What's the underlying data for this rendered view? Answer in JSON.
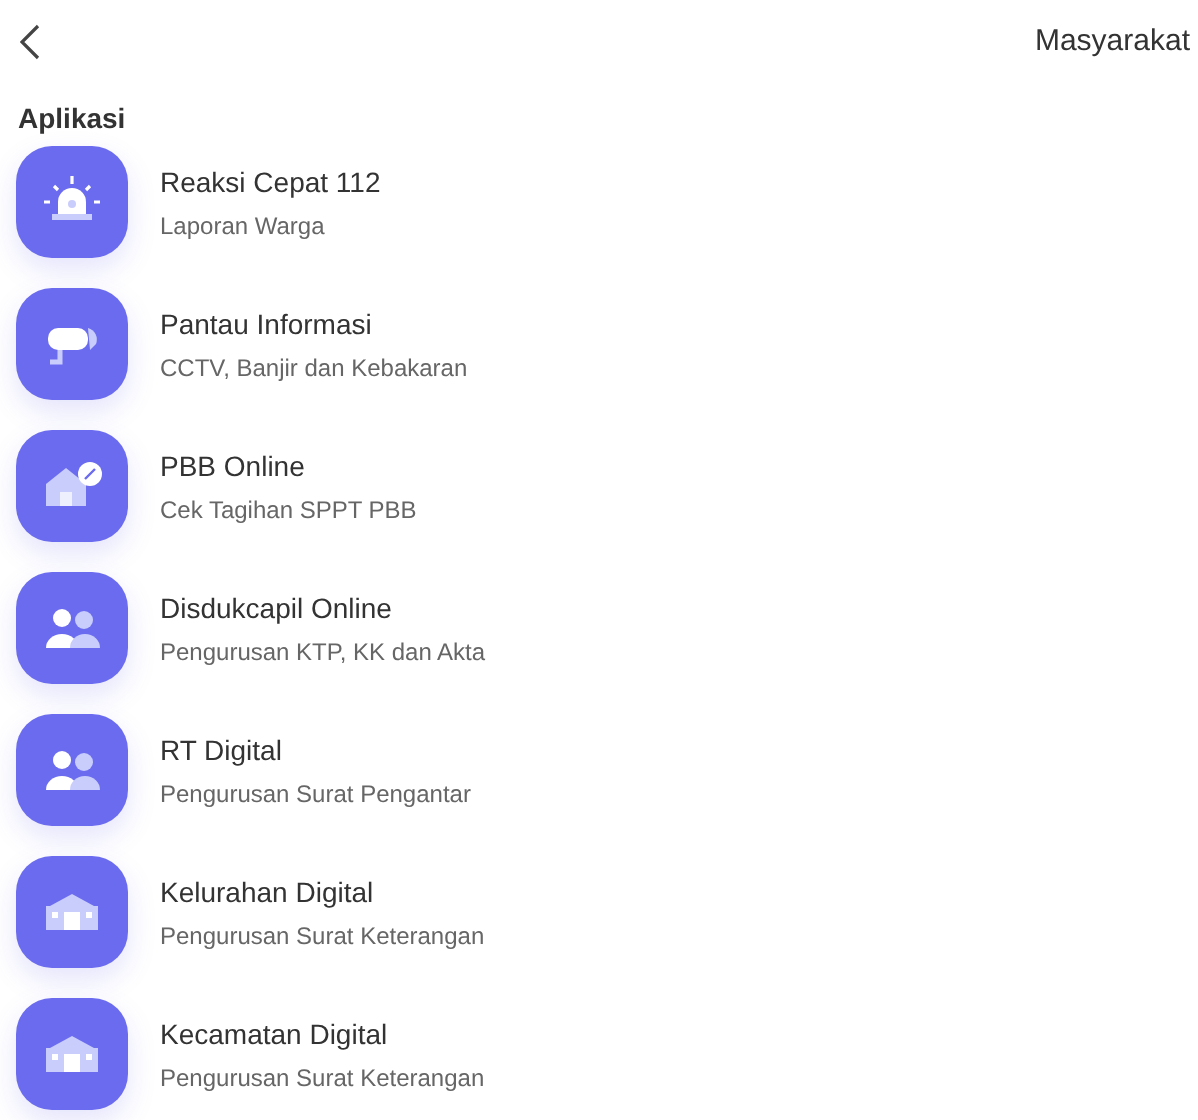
{
  "header": {
    "title": "Masyarakat"
  },
  "section": {
    "title": "Aplikasi"
  },
  "apps": [
    {
      "kind": "siren",
      "title": "Reaksi Cepat 112",
      "subtitle": "Laporan Warga"
    },
    {
      "kind": "cctv",
      "title": "Pantau Informasi",
      "subtitle": "CCTV, Banjir dan Kebakaran"
    },
    {
      "kind": "house",
      "title": "PBB Online",
      "subtitle": "Cek Tagihan SPPT PBB"
    },
    {
      "kind": "people",
      "title": "Disdukcapil Online",
      "subtitle": "Pengurusan KTP, KK dan Akta"
    },
    {
      "kind": "people",
      "title": "RT Digital",
      "subtitle": "Pengurusan Surat Pengantar"
    },
    {
      "kind": "building",
      "title": "Kelurahan Digital",
      "subtitle": "Pengurusan Surat Keterangan"
    },
    {
      "kind": "building",
      "title": "Kecamatan Digital",
      "subtitle": "Pengurusan Surat Keterangan"
    }
  ]
}
